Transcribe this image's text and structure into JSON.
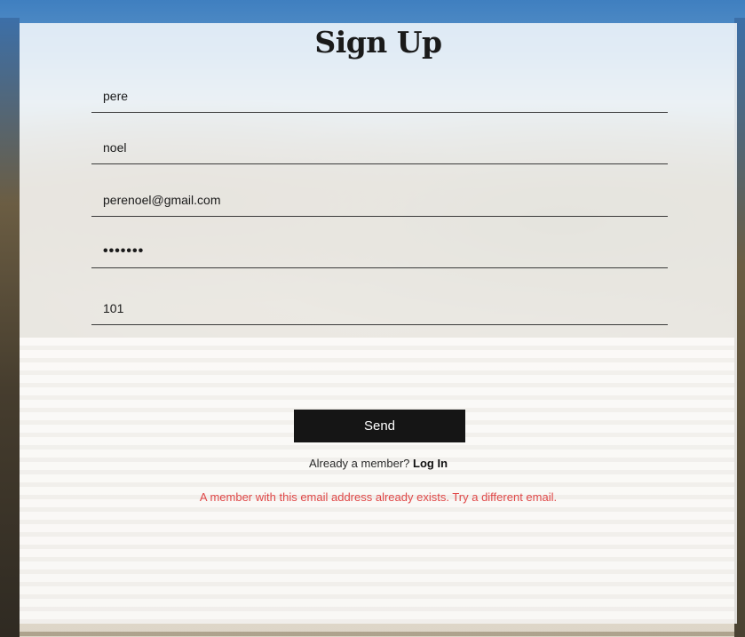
{
  "form": {
    "title": "Sign Up",
    "fields": [
      {
        "name": "first-name",
        "value": "pere"
      },
      {
        "name": "last-name",
        "value": "noel"
      },
      {
        "name": "email",
        "value": "perenoel@gmail.com"
      },
      {
        "name": "password",
        "value": "•••••••"
      },
      {
        "name": "room-number",
        "value": "101"
      }
    ],
    "send_label": "Send",
    "member_prompt": "Already a member?",
    "login_label": "Log In",
    "error_message": "A member with this email address already exists. Try a different email."
  },
  "colors": {
    "button_bg": "#151515",
    "error": "#e04848",
    "panel_overlay": "rgba(255,255,255,0.82)"
  }
}
